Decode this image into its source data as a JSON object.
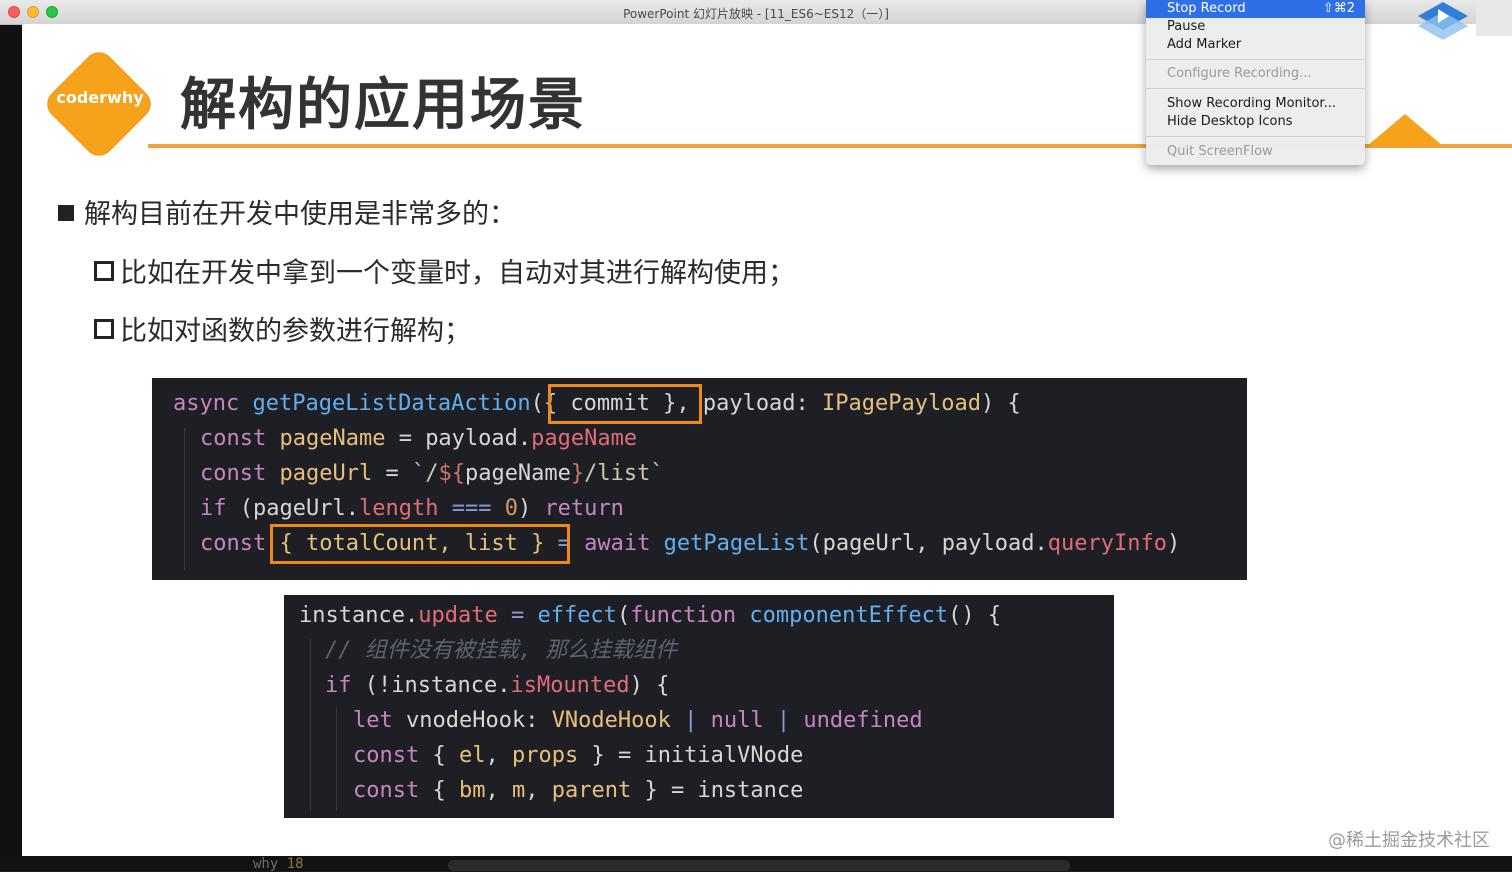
{
  "window": {
    "title": "PowerPoint 幻灯片放映 - [11_ES6~ES12（一）]"
  },
  "slide": {
    "logo_text": "coderwhy",
    "title": "解构的应用场景",
    "bullets": [
      {
        "level": 1,
        "text": "解构目前在开发中使用是非常多的："
      },
      {
        "level": 2,
        "text": "比如在开发中拿到一个变量时，自动对其进行解构使用；"
      },
      {
        "level": 2,
        "text": "比如对函数的参数进行解构；"
      }
    ]
  },
  "code1": {
    "l1": {
      "a": "async ",
      "b": "getPageListDataAction",
      "c": "(",
      "d": "{ commit }",
      "e": ", payload: ",
      "f": "IPagePayload",
      "g": ") {"
    },
    "l2": {
      "a": "const ",
      "b": "pageName",
      "c": " = payload.",
      "d": "pageName"
    },
    "l3": {
      "a": "const ",
      "b": "pageUrl",
      "c": " = ",
      "d": "`/",
      "e": "${",
      "f": "pageName",
      "g": "}",
      "h": "/list`"
    },
    "l4": {
      "a": "if ",
      "b": "(pageUrl.",
      "c": "length",
      "d": " === ",
      "e": "0",
      "f": ") ",
      "g": "return"
    },
    "l5": {
      "a": "const",
      "b": " { totalCount, list } ",
      "c": "= ",
      "d": "await ",
      "e": "getPageList",
      "f": "(pageUrl, payload.",
      "g": "queryInfo",
      "h": ")"
    }
  },
  "code2": {
    "l1": {
      "a": "instance.",
      "b": "update",
      "c": " = ",
      "d": "effect",
      "e": "(",
      "f": "function ",
      "g": "componentEffect",
      "h": "() {"
    },
    "l2": {
      "a": "// 组件没有被挂载, 那么挂载组件"
    },
    "l3": {
      "a": "if ",
      "b": "(!instance.",
      "c": "isMounted",
      "d": ") {"
    },
    "l4": {
      "a": "let ",
      "b": "vnodeHook: ",
      "c": "VNodeHook",
      "d": " | ",
      "e": "null",
      "f": " | ",
      "g": "undefined"
    },
    "l5": {
      "a": "const ",
      "b": "{ ",
      "c": "el",
      "d": ", ",
      "e": "props",
      "f": " } = initialVNode"
    },
    "l6": {
      "a": "const ",
      "b": "{ ",
      "c": "bm",
      "d": ", ",
      "e": "m",
      "f": ", ",
      "g": "parent",
      "h": " } = instance"
    }
  },
  "menu": {
    "stop_record": "Stop Record",
    "stop_shortcut": "⇧⌘2",
    "pause": "Pause",
    "add_marker": "Add Marker",
    "configure": "Configure Recording...",
    "show_monitor": "Show Recording Monitor...",
    "hide_icons": "Hide Desktop Icons",
    "quit": "Quit ScreenFlow"
  },
  "bottom": {
    "text": "why ",
    "number": "18"
  },
  "watermark": "@稀土掘金技术社区",
  "colors": {
    "accent": "#f7a21b",
    "highlight_box": "#ef8a1a",
    "code_bg": "#1e1f25",
    "menu_active": "#2f6fe6"
  }
}
